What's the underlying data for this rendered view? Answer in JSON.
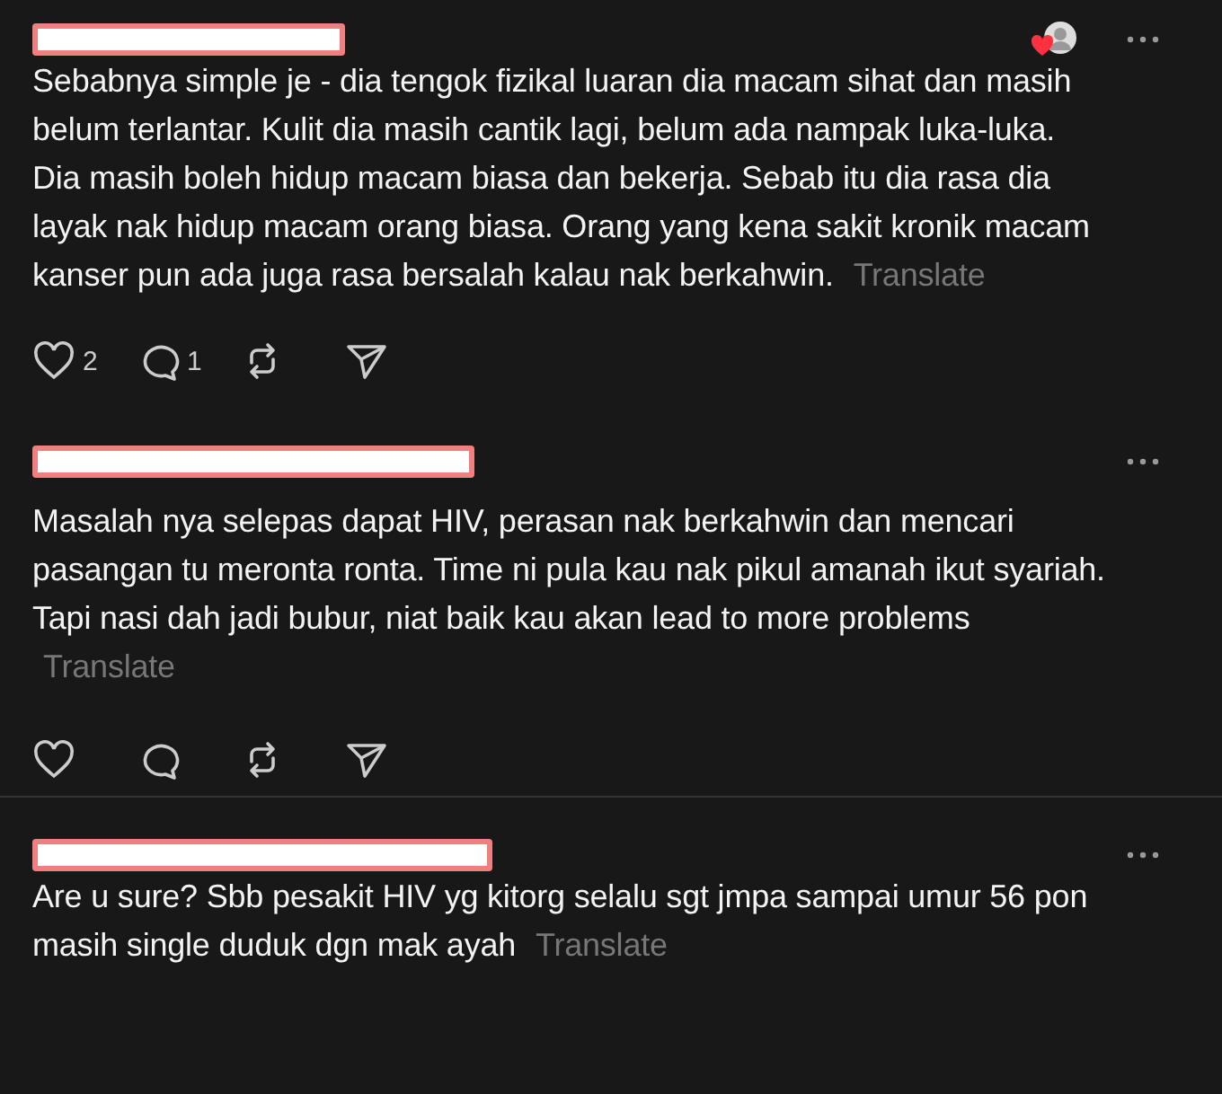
{
  "posts": [
    {
      "liked_by_author": true,
      "divider_before": false,
      "text": "Sebabnya simple je - dia tengok fizikal luaran dia macam sihat dan masih belum terlantar. Kulit dia masih cantik lagi, belum ada nampak luka-luka. Dia masih boleh hidup macam biasa dan bekerja. Sebab itu dia rasa dia layak nak hidup macam orang biasa. Orang yang kena sakit kronik macam kanser pun ada juga rasa bersalah kalau nak berkahwin.",
      "translate": "Translate",
      "likes": "2",
      "replies": "1",
      "show_actions": true
    },
    {
      "liked_by_author": false,
      "divider_before": false,
      "text": "Masalah nya selepas dapat HIV, perasan nak berkahwin dan mencari pasangan tu meronta ronta. Time ni pula kau nak pikul amanah ikut syariah. Tapi nasi dah jadi bubur, niat baik kau akan lead to more problems",
      "translate": "Translate",
      "show_actions": true
    },
    {
      "liked_by_author": false,
      "divider_before": true,
      "text": "Are u sure? Sbb pesakit HIV yg kitorg selalu sgt jmpa sampai umur 56 pon masih single duduk dgn mak ayah",
      "translate": "Translate",
      "show_actions": false
    }
  ]
}
